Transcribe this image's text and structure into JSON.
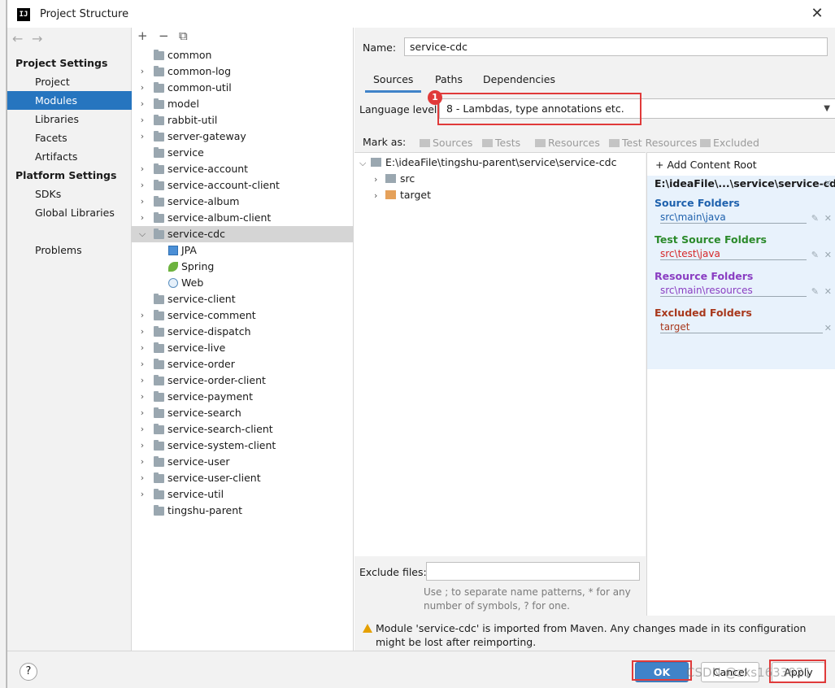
{
  "window": {
    "title": "Project Structure",
    "logo": "IJ"
  },
  "nav": {
    "sections": [
      {
        "heading": "Project Settings",
        "items": [
          "Project",
          "Modules",
          "Libraries",
          "Facets",
          "Artifacts"
        ]
      },
      {
        "heading": "Platform Settings",
        "items": [
          "SDKs",
          "Global Libraries"
        ]
      }
    ],
    "problems": "Problems",
    "selected": "Modules"
  },
  "tree": {
    "toolbar": {
      "add": "+",
      "remove": "−",
      "copy": "⧉"
    },
    "items": [
      {
        "label": "common",
        "expandable": false
      },
      {
        "label": "common-log",
        "expandable": true
      },
      {
        "label": "common-util",
        "expandable": true
      },
      {
        "label": "model",
        "expandable": true
      },
      {
        "label": "rabbit-util",
        "expandable": true
      },
      {
        "label": "server-gateway",
        "expandable": true
      },
      {
        "label": "service",
        "expandable": false
      },
      {
        "label": "service-account",
        "expandable": true
      },
      {
        "label": "service-account-client",
        "expandable": true
      },
      {
        "label": "service-album",
        "expandable": true
      },
      {
        "label": "service-album-client",
        "expandable": true
      },
      {
        "label": "service-cdc",
        "expandable": true,
        "expanded": true,
        "selected": true
      },
      {
        "label": "JPA",
        "child": true,
        "icon": "jpa-icon"
      },
      {
        "label": "Spring",
        "child": true,
        "icon": "spring-icon"
      },
      {
        "label": "Web",
        "child": true,
        "icon": "web-icon"
      },
      {
        "label": "service-client",
        "expandable": false
      },
      {
        "label": "service-comment",
        "expandable": true
      },
      {
        "label": "service-dispatch",
        "expandable": true
      },
      {
        "label": "service-live",
        "expandable": true
      },
      {
        "label": "service-order",
        "expandable": true
      },
      {
        "label": "service-order-client",
        "expandable": true
      },
      {
        "label": "service-payment",
        "expandable": true
      },
      {
        "label": "service-search",
        "expandable": true
      },
      {
        "label": "service-search-client",
        "expandable": true
      },
      {
        "label": "service-system-client",
        "expandable": true
      },
      {
        "label": "service-user",
        "expandable": true
      },
      {
        "label": "service-user-client",
        "expandable": true
      },
      {
        "label": "service-util",
        "expandable": true
      },
      {
        "label": "tingshu-parent",
        "expandable": false
      }
    ]
  },
  "module": {
    "name_label": "Name:",
    "name_value": "service-cdc",
    "tabs": [
      "Sources",
      "Paths",
      "Dependencies"
    ],
    "active_tab": "Sources",
    "language_level_label": "Language level:",
    "language_level_value": "8 - Lambdas, type annotations etc.",
    "badge": "1",
    "mark_as_label": "Mark as:",
    "mark_as": [
      "Sources",
      "Tests",
      "Resources",
      "Test Resources",
      "Excluded"
    ],
    "content_tree": {
      "root": "E:\\ideaFile\\tingshu-parent\\service\\service-cdc",
      "children": [
        {
          "label": "src",
          "color": "grey"
        },
        {
          "label": "target",
          "color": "orange"
        }
      ]
    },
    "roots_panel": {
      "add_root": "Add Content Root",
      "root_path": "E:\\ideaFile\\...\\service\\service-cdc",
      "source_folders_label": "Source Folders",
      "source_folders": [
        "src\\main\\java"
      ],
      "test_folders_label": "Test Source Folders",
      "test_folders": [
        "src\\test\\java"
      ],
      "resource_folders_label": "Resource Folders",
      "resource_folders": [
        "src\\main\\resources"
      ],
      "excluded_folders_label": "Excluded Folders",
      "excluded_folders": [
        "target"
      ]
    },
    "exclude_files_label": "Exclude files:",
    "exclude_files_value": "",
    "exclude_hint": "Use ; to separate name patterns, * for any number of symbols, ? for one.",
    "warning": "Module 'service-cdc' is imported from Maven. Any changes made in its configuration might be lost after reimporting."
  },
  "footer": {
    "help": "?",
    "ok": "OK",
    "cancel": "Cancel",
    "apply": "Apply",
    "watermark": "CSDN @zxs1633821"
  },
  "colors": {
    "selection": "#2675bf",
    "primary_button": "#4083c9",
    "highlight_box": "#e03a3a"
  }
}
